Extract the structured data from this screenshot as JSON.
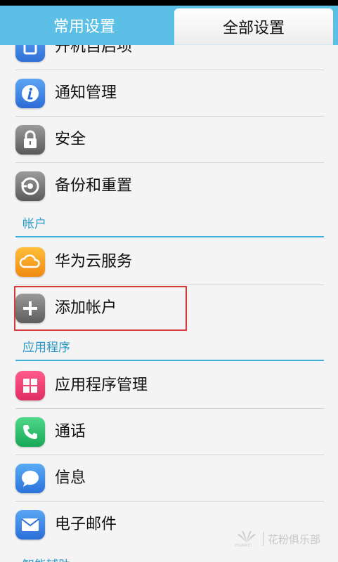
{
  "tabs": {
    "common": "常用设置",
    "all": "全部设置"
  },
  "rows": [
    {
      "label": "开机自启项",
      "icon": "app-square-icon"
    },
    {
      "label": "通知管理",
      "icon": "info-icon"
    },
    {
      "label": "安全",
      "icon": "lock-icon"
    },
    {
      "label": "备份和重置",
      "icon": "restore-icon"
    }
  ],
  "sections": {
    "account": {
      "title": "帐户",
      "items": [
        {
          "label": "华为云服务",
          "icon": "cloud-icon"
        },
        {
          "label": "添加帐户",
          "icon": "plus-icon"
        }
      ]
    },
    "apps": {
      "title": "应用程序",
      "items": [
        {
          "label": "应用程序管理",
          "icon": "app-grid-icon"
        },
        {
          "label": "通话",
          "icon": "phone-icon"
        },
        {
          "label": "信息",
          "icon": "chat-bubble-icon"
        },
        {
          "label": "电子邮件",
          "icon": "mail-icon"
        }
      ]
    },
    "assist": {
      "title": "智能辅助"
    }
  },
  "watermark": {
    "brand": "HUAWEI",
    "text": "花粉俱乐部"
  },
  "colors": {
    "tab_bar": "#5bbfe6",
    "section_line": "#3bb0d8",
    "highlight": "#d8393a"
  }
}
